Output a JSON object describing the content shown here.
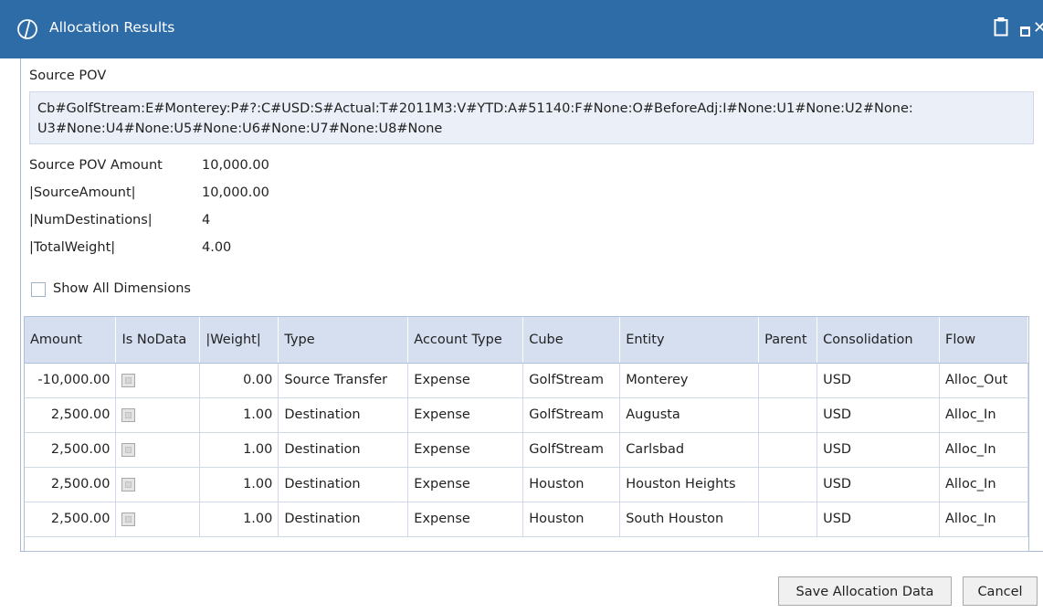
{
  "window": {
    "title": "Allocation Results"
  },
  "source_pov": {
    "heading": "Source POV",
    "line1": "Cb#GolfStream:E#Monterey:P#?:C#USD:S#Actual:T#2011M3:V#YTD:A#51140:F#None:O#BeforeAdj:I#None:U1#None:U2#None:",
    "line2": "U3#None:U4#None:U5#None:U6#None:U7#None:U8#None"
  },
  "summary": [
    {
      "label": "Source POV Amount",
      "value": "10,000.00"
    },
    {
      "label": "|SourceAmount|",
      "value": "10,000.00"
    },
    {
      "label": "|NumDestinations|",
      "value": "4"
    },
    {
      "label": "|TotalWeight|",
      "value": "4.00"
    }
  ],
  "show_all_dimensions": {
    "label": "Show All Dimensions",
    "checked": false
  },
  "grid": {
    "columns": [
      "Amount",
      "Is NoData",
      "|Weight|",
      "Type",
      "Account Type",
      "Cube",
      "Entity",
      "Parent",
      "Consolidation",
      "Flow"
    ],
    "rows": [
      [
        "-10,000.00",
        "",
        "0.00",
        "Source Transfer",
        "Expense",
        "GolfStream",
        "Monterey",
        "",
        "USD",
        "Alloc_Out"
      ],
      [
        "2,500.00",
        "",
        "1.00",
        "Destination",
        "Expense",
        "GolfStream",
        "Augusta",
        "",
        "USD",
        "Alloc_In"
      ],
      [
        "2,500.00",
        "",
        "1.00",
        "Destination",
        "Expense",
        "GolfStream",
        "Carlsbad",
        "",
        "USD",
        "Alloc_In"
      ],
      [
        "2,500.00",
        "",
        "1.00",
        "Destination",
        "Expense",
        "Houston",
        "Houston Heights",
        "",
        "USD",
        "Alloc_In"
      ],
      [
        "2,500.00",
        "",
        "1.00",
        "Destination",
        "Expense",
        "Houston",
        "South Houston",
        "",
        "USD",
        "Alloc_In"
      ]
    ]
  },
  "buttons": {
    "save": "Save Allocation Data",
    "cancel": "Cancel"
  },
  "colors": {
    "titlebar": "#2e6ca7",
    "grid_header": "#d5dff0",
    "pov_box": "#ebeff8"
  }
}
